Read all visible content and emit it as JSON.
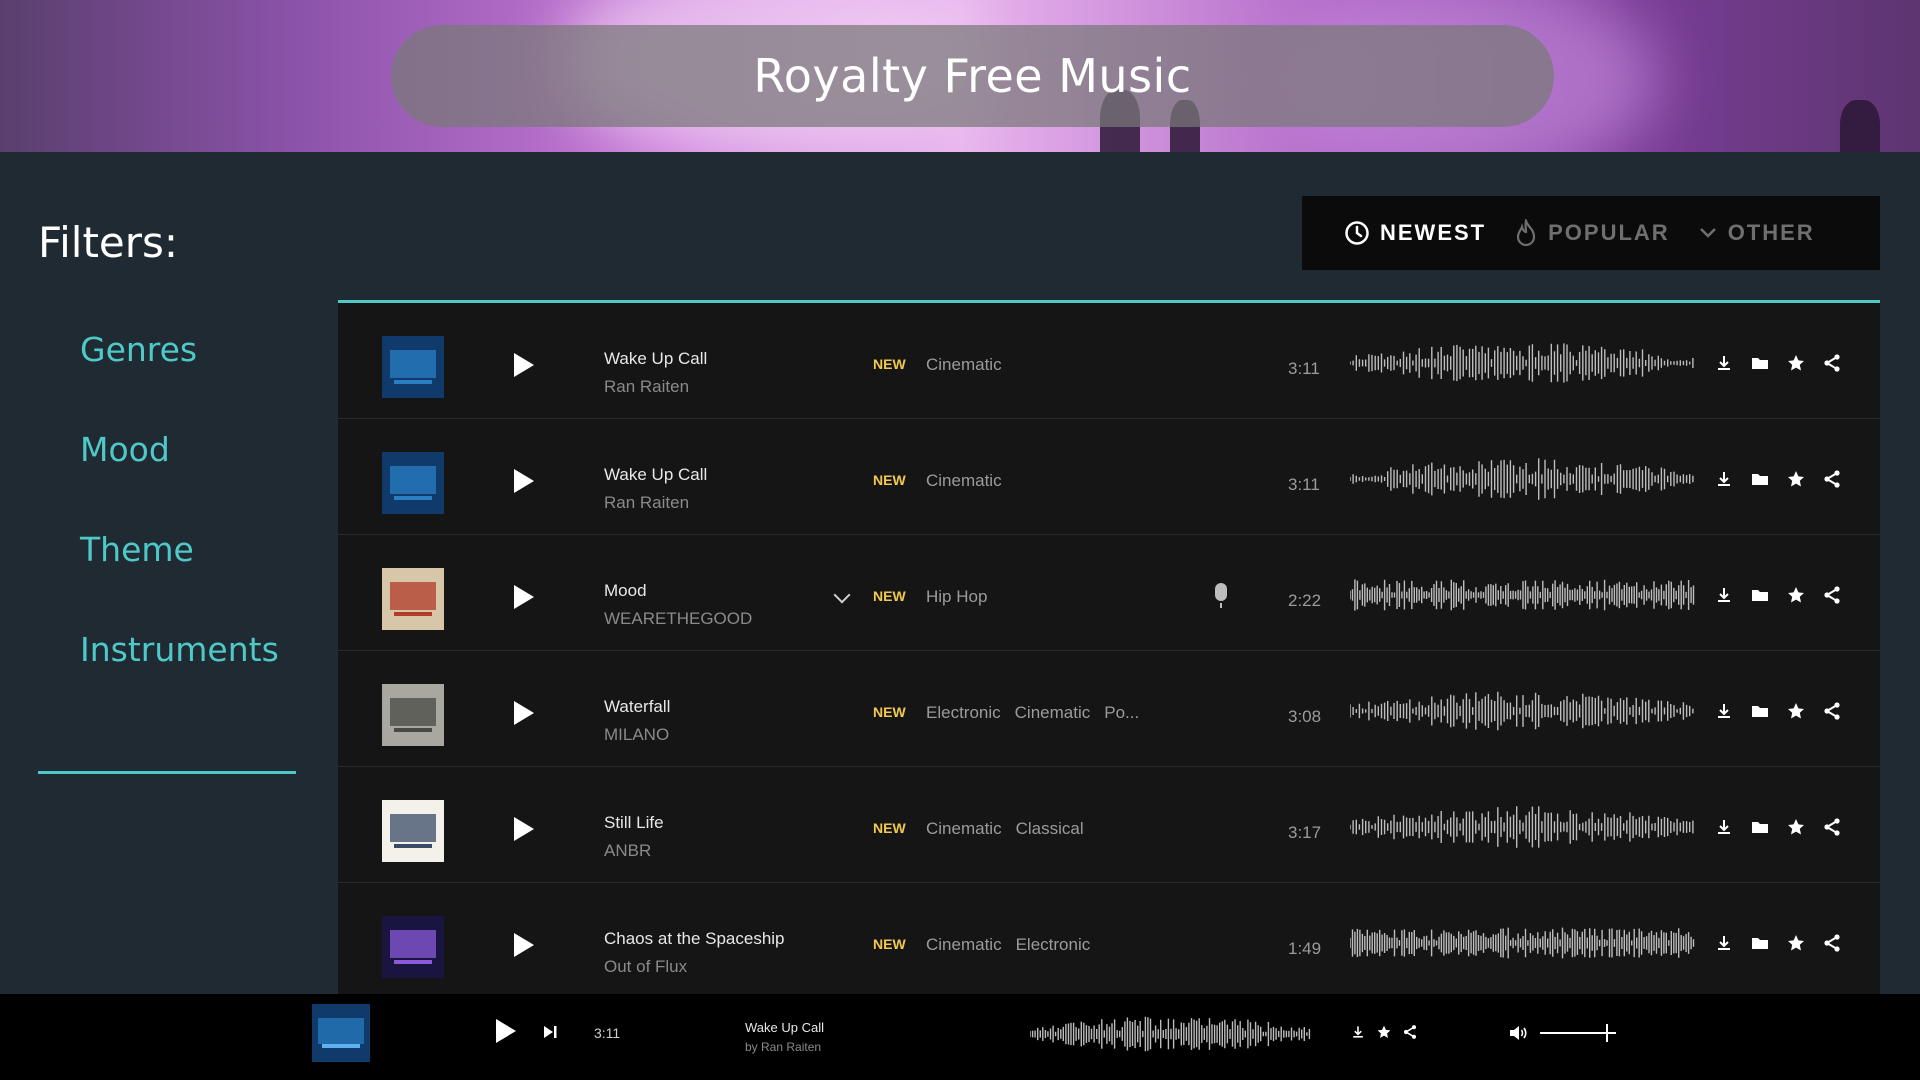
{
  "header": {
    "title": "Royalty Free Music"
  },
  "sidebar": {
    "title": "Filters:",
    "items": [
      {
        "label": "Genres"
      },
      {
        "label": "Mood"
      },
      {
        "label": "Theme"
      },
      {
        "label": "Instruments"
      }
    ]
  },
  "sort": {
    "items": [
      {
        "label": "NEWEST",
        "icon": "clock-icon",
        "active": true
      },
      {
        "label": "POPULAR",
        "icon": "flame-icon",
        "active": false
      },
      {
        "label": "OTHER",
        "icon": "chevron-down-icon",
        "active": false
      }
    ]
  },
  "tracks": [
    {
      "name": "Wake Up Call",
      "artist": "Ran Raiten",
      "tag": "NEW",
      "genres": [
        "Cinematic"
      ],
      "duration": "3:11",
      "thumb_colors": [
        "#0f3a6a",
        "#2a7fc4"
      ],
      "has_dropdown": false,
      "has_vocals": false
    },
    {
      "name": "Wake Up Call",
      "artist": "Ran Raiten",
      "tag": "NEW",
      "genres": [
        "Cinematic"
      ],
      "duration": "3:11",
      "thumb_colors": [
        "#0f3a6a",
        "#2a7fc4"
      ],
      "has_dropdown": false,
      "has_vocals": false
    },
    {
      "name": "Mood",
      "artist": "WEARETHEGOOD",
      "tag": "NEW",
      "genres": [
        "Hip Hop"
      ],
      "duration": "2:22",
      "thumb_colors": [
        "#d8c6a8",
        "#b23b2a"
      ],
      "has_dropdown": true,
      "has_vocals": true
    },
    {
      "name": "Waterfall",
      "artist": "MILANO",
      "tag": "NEW",
      "genres": [
        "Electronic",
        "Cinematic",
        "Po..."
      ],
      "duration": "3:08",
      "thumb_colors": [
        "#a8a8a0",
        "#4a4a44"
      ],
      "has_dropdown": false,
      "has_vocals": false
    },
    {
      "name": "Still Life",
      "artist": "ANBR",
      "tag": "NEW",
      "genres": [
        "Cinematic",
        "Classical"
      ],
      "duration": "3:17",
      "thumb_colors": [
        "#f4f1ea",
        "#3a4a66"
      ],
      "has_dropdown": false,
      "has_vocals": false
    },
    {
      "name": "Chaos at the Spaceship",
      "artist": "Out of Flux",
      "tag": "NEW",
      "genres": [
        "Cinematic",
        "Electronic"
      ],
      "duration": "1:49",
      "thumb_colors": [
        "#1a1440",
        "#8a5ad8"
      ],
      "has_dropdown": false,
      "has_vocals": false
    }
  ],
  "track_actions": [
    "download-icon",
    "folder-icon",
    "star-icon",
    "share-icon"
  ],
  "player": {
    "time": "3:11",
    "name": "Wake Up Call",
    "artist": "by Ran Raiten",
    "volume": 0.9
  },
  "colors": {
    "accent": "#4fc9c8",
    "new_tag": "#f2c94c",
    "list_bg": "#151515",
    "page_bg": "#1f2a33"
  }
}
